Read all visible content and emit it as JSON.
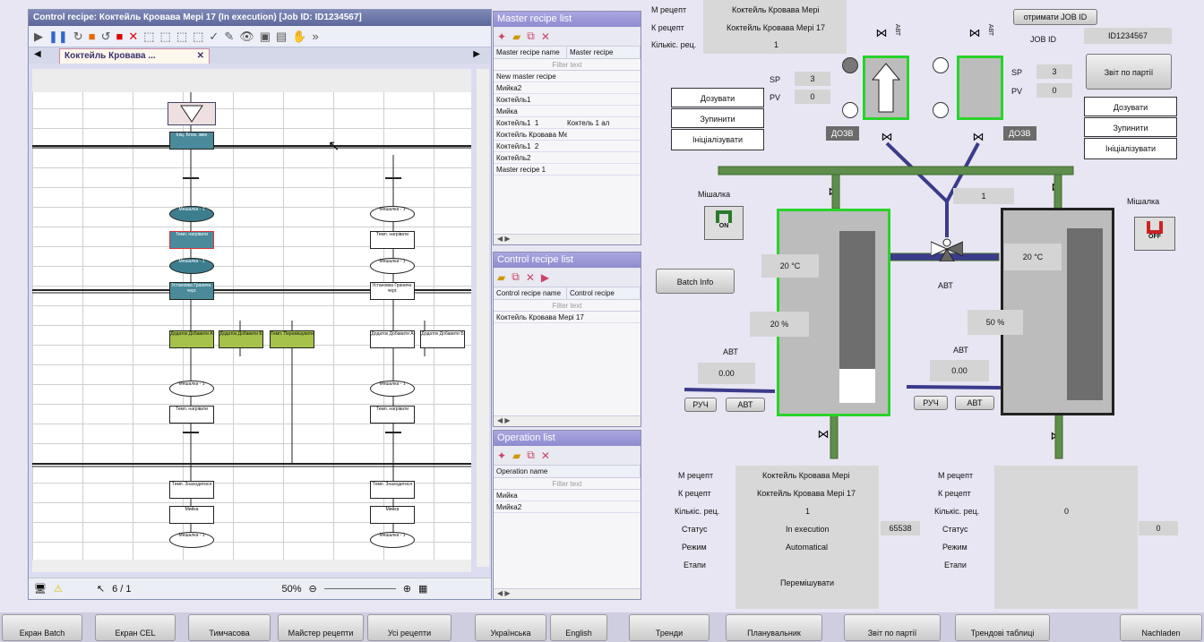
{
  "editor": {
    "title": "Control recipe: Коктейль Кровава Мері 17 (In execution) [Job ID: ID1234567]",
    "tab": "Коктейль Кровава ...",
    "page": "6 / 1",
    "zoom": "50%"
  },
  "master_list": {
    "title": "Master recipe list",
    "col1": "Master recipe name",
    "col2": "Master recipe",
    "filter": "Filter text",
    "rows": [
      {
        "name": "New master recipe",
        "extra": ""
      },
      {
        "name": "Мийка2",
        "extra": ""
      },
      {
        "name": "Коктейль1",
        "extra": ""
      },
      {
        "name": "Мийка",
        "extra": ""
      },
      {
        "name": "Коктейль1_1",
        "extra": "Коктель 1 ал"
      },
      {
        "name": "Коктейль Кровава Мері",
        "extra": ""
      },
      {
        "name": "Коктейль1_2",
        "extra": ""
      },
      {
        "name": "Коктейль2",
        "extra": ""
      },
      {
        "name": "Master recipe 1",
        "extra": ""
      }
    ]
  },
  "control_list": {
    "title": "Control recipe list",
    "col1": "Control recipe name",
    "col2": "Control recipe",
    "filter": "Filter text",
    "rows": [
      {
        "name": "Коктейль Кровава Мері 17"
      }
    ]
  },
  "operation_list": {
    "title": "Operation list",
    "col1": "Operation name",
    "filter": "Filter text",
    "rows": [
      {
        "name": "Мийка"
      },
      {
        "name": "Мийка2"
      }
    ]
  },
  "scada": {
    "m_recipe_label": "М рецепт",
    "k_recipe_label": "К рецепт",
    "count_label": "Кількіс. рец.",
    "top_m_recipe": "Коктейль Кровава Мері",
    "top_k_recipe": "Коктейль Кровава Мері 17",
    "top_count": "1",
    "get_job_btn": "отримати JOB ID",
    "job_id_label": "JOB ID",
    "job_id_value": "ID1234567",
    "report_btn": "Звіт по партії",
    "sp_label": "SP",
    "pv_label": "PV",
    "left_sp": "3",
    "left_pv": "0",
    "right_sp": "3",
    "right_pv": "0",
    "dose_btn": "Дозувати",
    "stop_btn": "Зупинити",
    "init_btn": "Ініціалізувати",
    "dozv": "ДОЗВ",
    "avt": "АВТ",
    "ruch": "РУЧ",
    "mixer_label": "Мішалка",
    "mixer_left_state": "ON",
    "mixer_right_state": "OFF",
    "batch_info_btn": "Batch Info",
    "middle_count": "1",
    "left_temp": "20 °C",
    "left_level": "20 %",
    "left_level_fraction": 0.2,
    "right_temp": "20 °C",
    "right_level": "50 %",
    "left_avt_value": "0.00",
    "right_avt_value": "0.00",
    "status_label": "Статус",
    "mode_label": "Режим",
    "stages_label": "Етапи",
    "left_info": {
      "m_recipe": "Коктейль Кровава Мері",
      "k_recipe": "Коктейль Кровава Мері 17",
      "count": "1",
      "status": "In execution",
      "status_code": "65538",
      "mode": "Automatical",
      "stage": "Перемішувати"
    },
    "right_info": {
      "count": "0",
      "status_code": "0"
    }
  },
  "nav": [
    "Екран Batch",
    "Екран CEL",
    "Тимчасова",
    "Майстер рецепти",
    "Усі рецепти",
    "Українська",
    "English",
    "Тренди",
    "Планувальник",
    "Звіт по партії",
    "Трендові таблиці",
    "Nachladen"
  ],
  "sfc_labels": {
    "start": "Ініц. \nБлок. змін",
    "n1": "Мешалка - 1",
    "n2": "Темп. нагрівати",
    "n3": "Мешалка - 1",
    "n4": "Установка Граничн. черг.",
    "add_a": "Додаток Добавити А",
    "add_b": "Додаток Добавити Б",
    "mix": "Темп. Перемішувати",
    "n5": "Мешалка - 1",
    "n6": "Темп. нагрівати",
    "n7": "Темп. Знаходитися",
    "n8": "Мийка",
    "n9": "Мешалка - 1"
  }
}
